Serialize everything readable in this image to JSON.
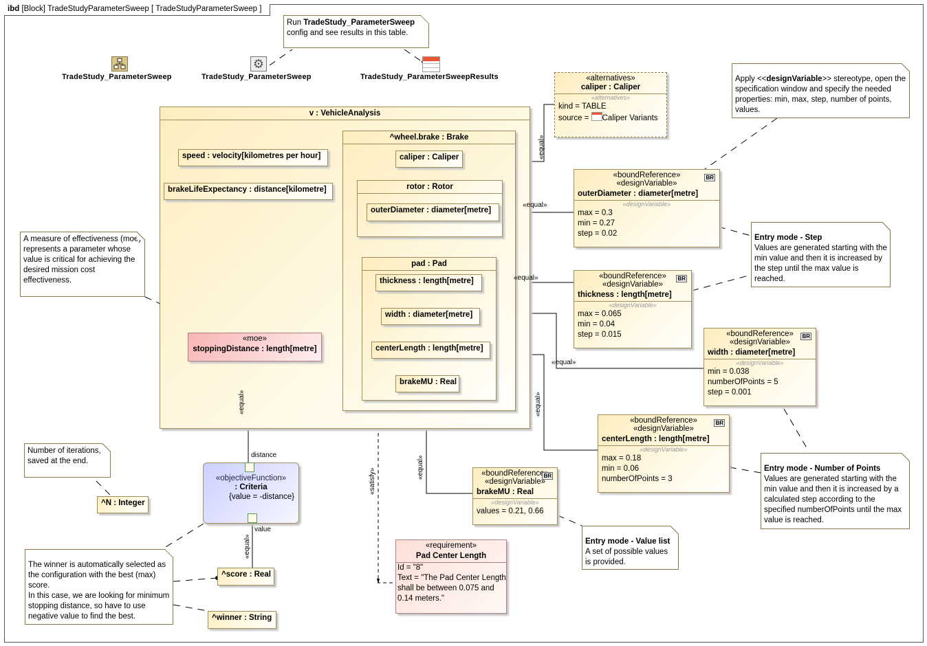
{
  "frame": {
    "kind": "ibd",
    "title": "[Block] TradeStudyParameterSweep [ TradeStudyParameterSweep ]"
  },
  "run_note": {
    "prefix": "Run ",
    "bold": "TradeStudy_ParameterSweep",
    "line2": "config and see results in this table."
  },
  "artifacts": [
    {
      "label": "TradeStudy_ParameterSweep",
      "icon": "block-diagram-icon"
    },
    {
      "label": "TradeStudy_ParameterSweep",
      "icon": "gear-simulation-config-icon"
    },
    {
      "label": "TradeStudy_ParameterSweepResults",
      "icon": "table-icon"
    }
  ],
  "vehicle": {
    "title": "v : VehicleAnalysis",
    "speed": "speed : velocity[kilometres per hour]",
    "brakeLife": "brakeLifeExpectancy : distance[kilometre]",
    "brake": {
      "title": "^wheel.brake : Brake",
      "caliper": "caliper : Caliper",
      "rotor": {
        "title": "rotor : Rotor",
        "outerDiameter": "outerDiameter : diameter[metre]"
      },
      "pad": {
        "title": "pad : Pad",
        "thickness": "thickness : length[metre]",
        "width": "width : diameter[metre]",
        "centerLength": "centerLength : length[metre]",
        "brakeMU": "brakeMU : Real"
      }
    }
  },
  "moe": {
    "stereo": "«moe»",
    "name": "stoppingDistance : length[metre]"
  },
  "moe_note": "A measure of effectiveness (moe) represents a parameter whose value is critical for achieving the desired mission cost effectiveness.",
  "criteria": {
    "stereo": "«objectiveFunction»",
    "name": ": Criteria",
    "constraint": "{value = -distance}",
    "port_in": "distance",
    "port_out": "value"
  },
  "iter_note": "Number of iterations, saved at the end.",
  "n": "^N : Integer",
  "score": "^score : Real",
  "winner": "^winner : String",
  "winner_note": [
    "The winner is automatically selected as the configuration with the best (max) score.",
    "In this case, we are looking for minimum stopping distance, so have to use negative value to find the best."
  ],
  "alternatives": {
    "stereo": "«alternatives»",
    "name": "caliper : Caliper",
    "compartment": "«alternatives»",
    "kind": "kind = TABLE",
    "source_prefix": "source = ",
    "source": "Caliper Variants"
  },
  "apply_note": {
    "pre": "Apply <<",
    "bold": "designVariable",
    "post": ">> stereotype, open the specification window and specify the needed properties: min, max, step, number of points, values."
  },
  "bound": {
    "s1": "«boundReference»",
    "s2": "«designVariable»",
    "comp": "«designVariable»",
    "badge": "BR",
    "outerDiameter": {
      "name": "outerDiameter : diameter[metre]",
      "attrs": [
        "max = 0.3",
        "min = 0.27",
        "step = 0.02"
      ]
    },
    "thickness": {
      "name": "thickness : length[metre]",
      "attrs": [
        "max = 0.065",
        "min = 0.04",
        "step = 0.015"
      ]
    },
    "width": {
      "name": "width : diameter[metre]",
      "attrs": [
        "min = 0.038",
        "numberOfPoints = 5",
        "step = 0.001"
      ]
    },
    "centerLength": {
      "name": "centerLength : length[metre]",
      "attrs": [
        "max = 0.18",
        "min = 0.06",
        "numberOfPoints = 3"
      ]
    },
    "brakeMU": {
      "name": "brakeMU : Real",
      "attrs": [
        "values = 0.21, 0.66"
      ]
    }
  },
  "requirement": {
    "stereo": "«requirement»",
    "name": "Pad Center Length",
    "id": "Id = \"8\"",
    "text": "Text = \"The Pad Center Length shall be between 0.075 and 0.14 meters.\""
  },
  "step_note": {
    "title": "Entry mode - Step",
    "body": "Values are generated starting with the min value and then it is increased by the step until the max value is reached."
  },
  "points_note": {
    "title": "Entry mode - Number of Points",
    "body": "Values are generated starting with the min value and then it is increased by a calculated step according to the specified numberOfPoints until the max value is reached."
  },
  "list_note": {
    "title": "Entry mode - Value list",
    "body": "A set of possible values is provided."
  },
  "connectors": {
    "equal": "«equal»",
    "satisfy": "«satisfy»"
  },
  "colors": {
    "block_fill": "#fdeebf",
    "moe_fill": "#f8b4b4",
    "objective_fill": "#d0d4ff",
    "requirement_fill": "#fde8e0",
    "border": "#a08c5a"
  }
}
